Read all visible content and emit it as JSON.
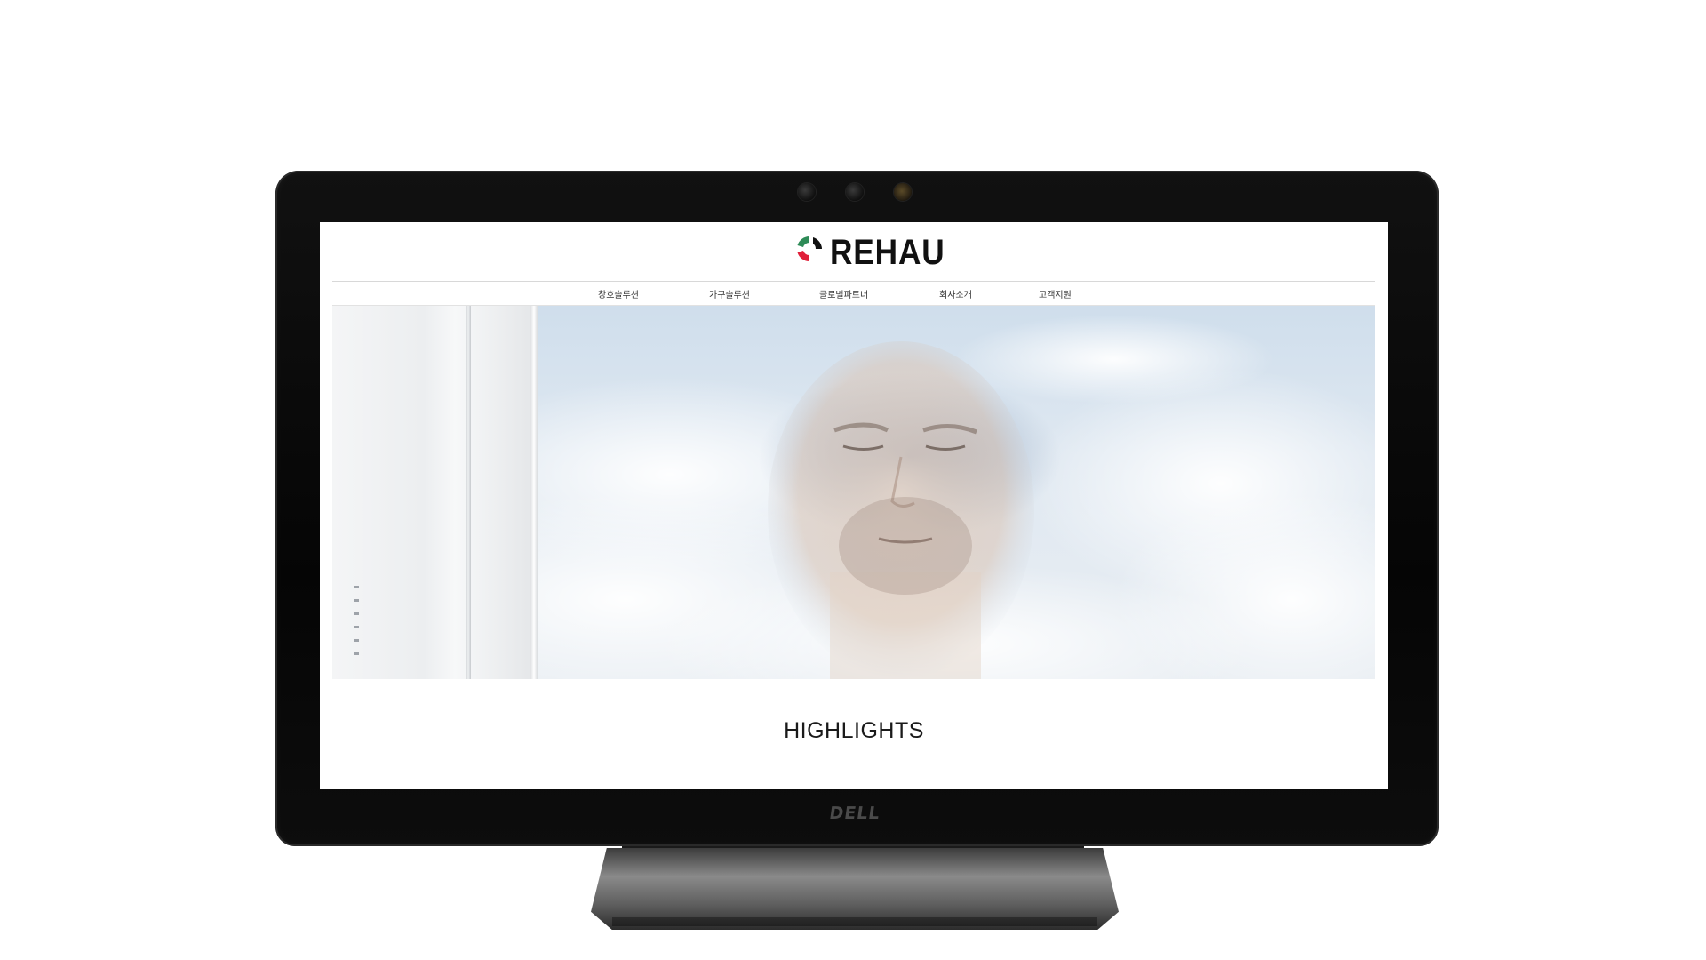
{
  "device": {
    "brand_label": "DELL"
  },
  "site": {
    "logo_text": "REHAU",
    "logo_colors": {
      "green": "#2e8b57",
      "red": "#e0203a",
      "text": "#111111"
    },
    "nav": [
      {
        "label": "창호솔루션"
      },
      {
        "label": "가구솔루션"
      },
      {
        "label": "글로벌파트너"
      },
      {
        "label": "회사소개"
      },
      {
        "label": "고객지원"
      }
    ],
    "hero_alt": "",
    "section_title": "HIGHLIGHTS"
  }
}
